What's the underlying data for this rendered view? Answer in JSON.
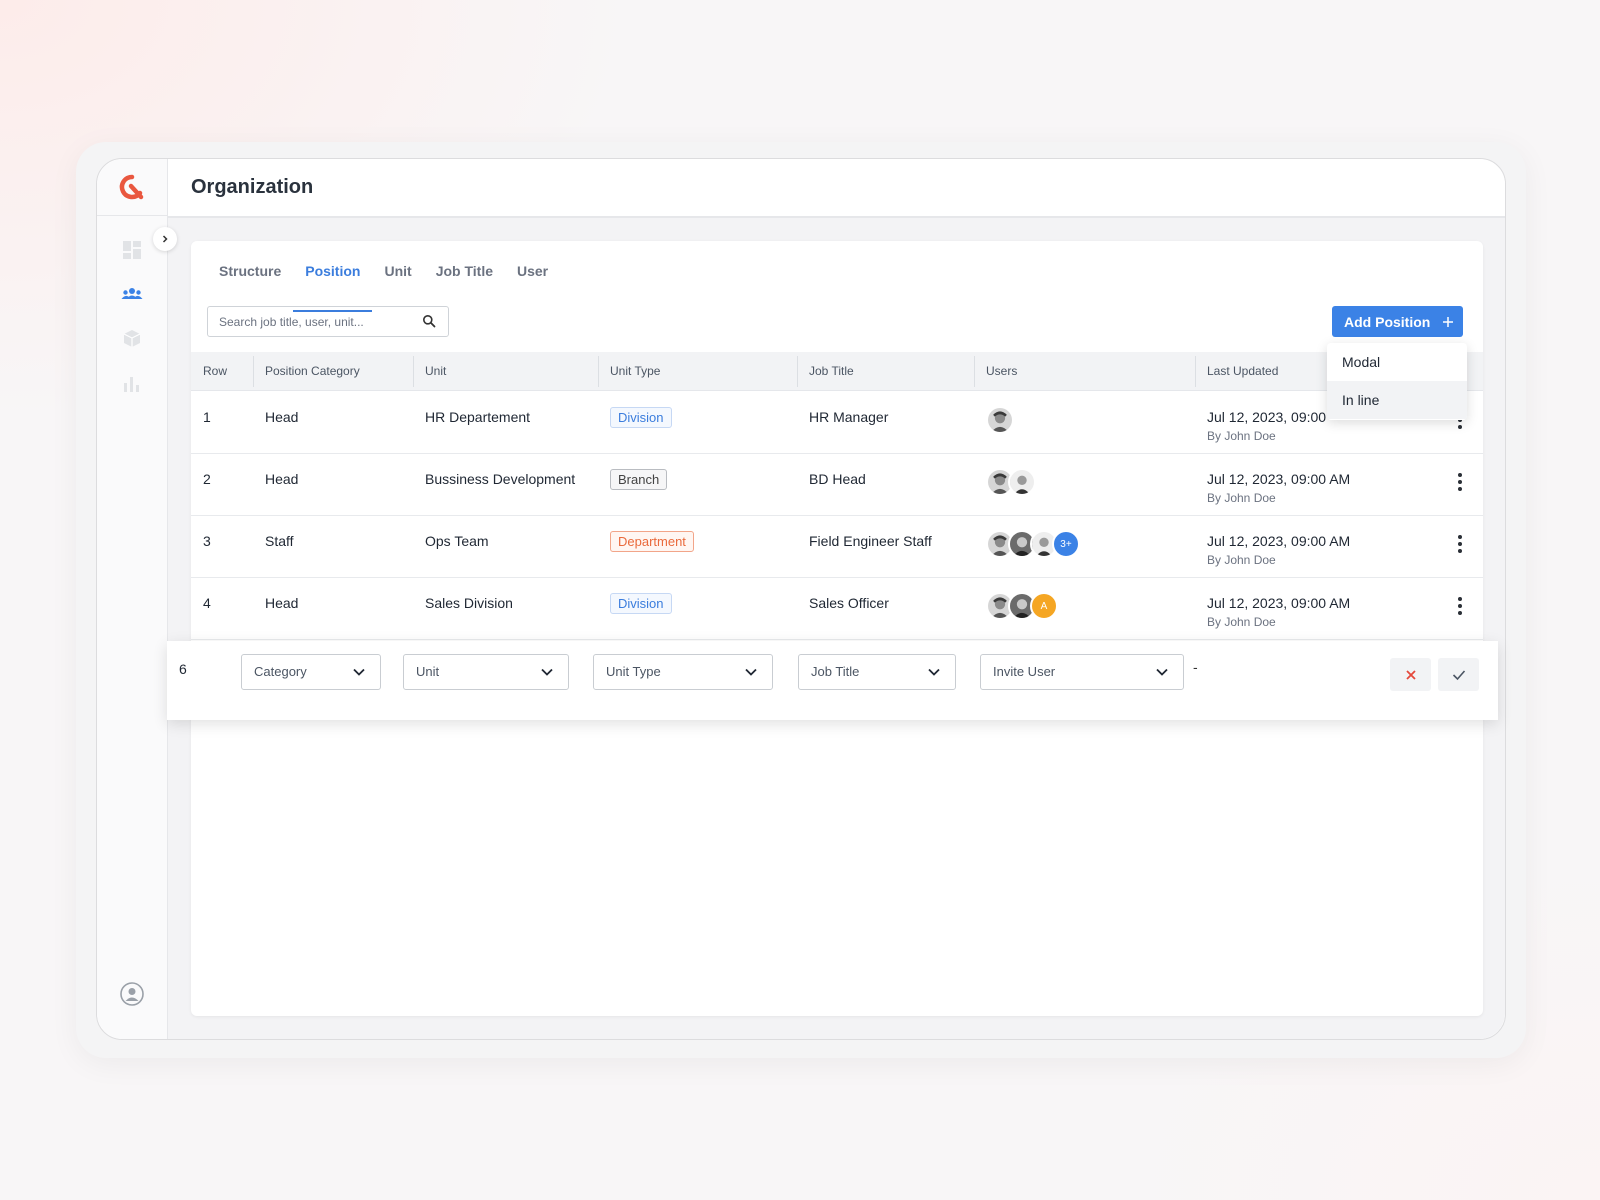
{
  "page": {
    "title": "Organization"
  },
  "tabs": [
    {
      "label": "Structure"
    },
    {
      "label": "Position"
    },
    {
      "label": "Unit"
    },
    {
      "label": "Job Title"
    },
    {
      "label": "User"
    }
  ],
  "search": {
    "placeholder": "Search job title, user, unit..."
  },
  "add_button": {
    "label": "Add Position",
    "icon": "plus-icon"
  },
  "dropdown": {
    "items": [
      {
        "label": "Modal"
      },
      {
        "label": "In line"
      }
    ]
  },
  "table": {
    "headers": [
      "Row",
      "Position Category",
      "Unit",
      "Unit  Type",
      "Job Title",
      "Users",
      "Last Updated"
    ],
    "rows": [
      {
        "row": "1",
        "category": "Head",
        "unit": "HR Departement",
        "unit_type": "Division",
        "job_title": "HR Manager",
        "updated": "Jul 12, 2023, 09:00",
        "by": "By John Doe"
      },
      {
        "row": "2",
        "category": "Head",
        "unit": "Bussiness Development",
        "unit_type": "Branch",
        "job_title": "BD Head",
        "updated": "Jul 12, 2023, 09:00 AM",
        "by": "By John Doe"
      },
      {
        "row": "3",
        "category": "Staff",
        "unit": "Ops Team",
        "unit_type": "Department",
        "job_title": "Field Engineer Staff",
        "updated": "Jul 12, 2023, 09:00 AM",
        "by": "By John Doe",
        "more_users": "3+"
      },
      {
        "row": "4",
        "category": "Head",
        "unit": "Sales Division",
        "unit_type": "Division",
        "job_title": "Sales Officer",
        "updated": "Jul 12, 2023, 09:00 AM",
        "by": "By John Doe",
        "initial": "A"
      }
    ]
  },
  "inline_row": {
    "row": "6",
    "category_placeholder": "Category",
    "unit_placeholder": "Unit",
    "unit_type_placeholder": "Unit Type",
    "job_title_placeholder": "Job Title",
    "user_placeholder": "Invite User",
    "last_updated": "-"
  },
  "colors": {
    "accent": "#3b82e6",
    "brand": "#e9573f",
    "division": "#3b7ddd",
    "department": "#ea6a3c"
  },
  "sidebar": {
    "icons": [
      "dashboard-icon",
      "people-icon",
      "box-icon",
      "bar-chart-icon",
      "user-circle-icon"
    ]
  }
}
